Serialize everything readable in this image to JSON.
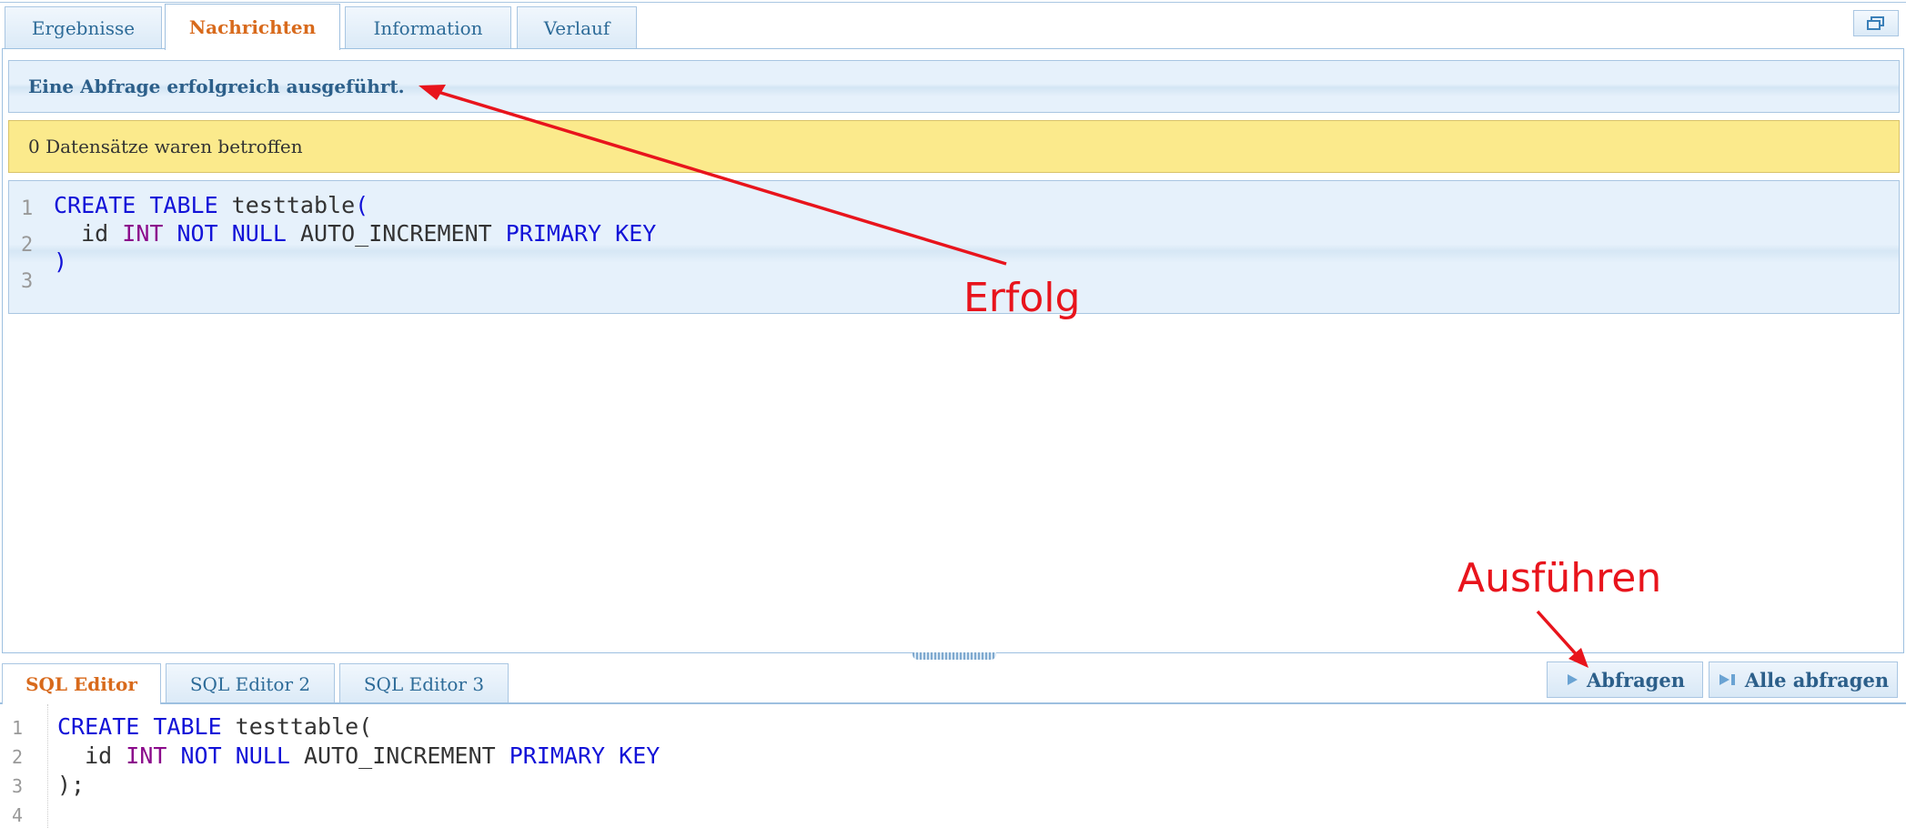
{
  "result_tabs": [
    {
      "label": "Ergebnisse",
      "active": false
    },
    {
      "label": "Nachrichten",
      "active": true
    },
    {
      "label": "Information",
      "active": false
    },
    {
      "label": "Verlauf",
      "active": false
    }
  ],
  "messages": {
    "success": "Eine Abfrage erfolgreich ausgeführt.",
    "affected": "0 Datensätze waren betroffen"
  },
  "query_display": {
    "line_numbers": [
      "1",
      "2",
      "3"
    ]
  },
  "editor_tabs": [
    {
      "label": "SQL Editor",
      "active": true
    },
    {
      "label": "SQL Editor 2",
      "active": false
    },
    {
      "label": "SQL Editor 3",
      "active": false
    }
  ],
  "buttons": {
    "run": "Abfragen",
    "run_icon": "play-icon",
    "run_all": "Alle abfragen",
    "run_all_icon": "skip-forward-icon",
    "restore_icon": "restore-window-icon"
  },
  "editor": {
    "line_numbers": [
      "1",
      "2",
      "3",
      "4"
    ]
  },
  "annotations": {
    "success_label": "Erfolg",
    "run_label": "Ausführen",
    "color": "#e8141c"
  },
  "colors": {
    "active_tab_text": "#d86a1c",
    "tab_text": "#2d6b98",
    "keyword": "#1212d8",
    "type": "#8b0a8b",
    "warning_bg": "#fbea8c",
    "info_bg": "#e6f1fb"
  }
}
